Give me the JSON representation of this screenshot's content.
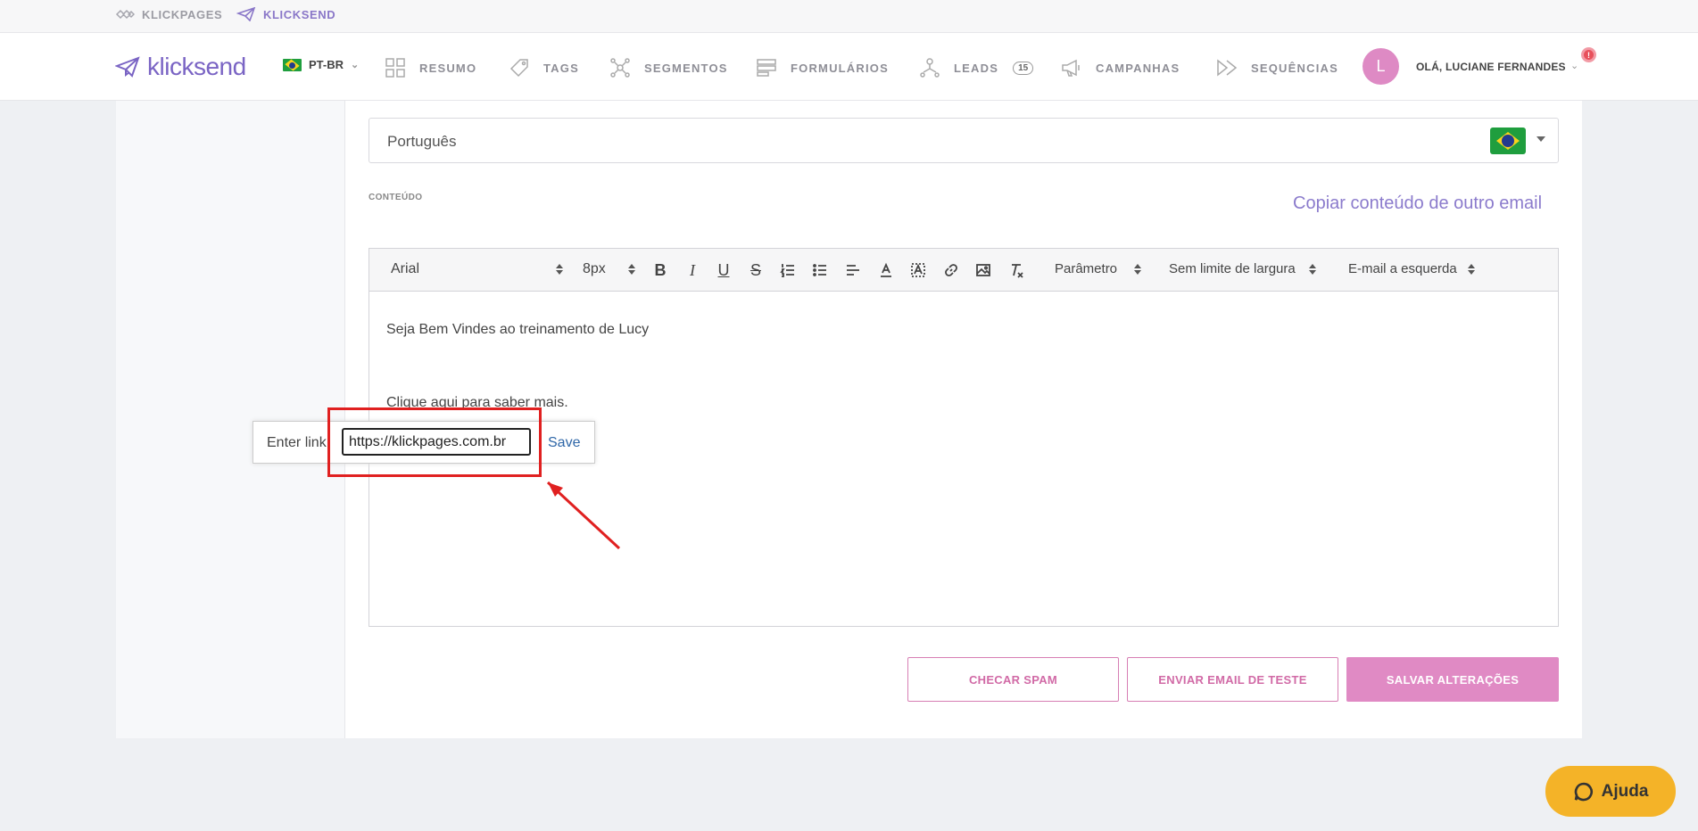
{
  "topbar": {
    "links": [
      {
        "label": "KLICKPAGES",
        "icon": "klickpages-icon"
      },
      {
        "label": "KLICKSEND",
        "icon": "paper-plane-icon"
      }
    ]
  },
  "header": {
    "logo_text": "klicksend",
    "language": "PT-BR",
    "nav": [
      {
        "label": "RESUMO",
        "icon": "grid-icon"
      },
      {
        "label": "TAGS",
        "icon": "tag-icon"
      },
      {
        "label": "SEGMENTOS",
        "icon": "segments-icon"
      },
      {
        "label": "FORMULÁRIOS",
        "icon": "form-icon"
      },
      {
        "label": "LEADS",
        "icon": "leads-icon",
        "badge": "15"
      },
      {
        "label": "CAMPANHAS",
        "icon": "megaphone-icon"
      },
      {
        "label": "SEQUÊNCIAS",
        "icon": "sequence-icon"
      }
    ],
    "avatar_initial": "L",
    "greeting": "OLÁ, LUCIANE FERNANDES",
    "notification": "!"
  },
  "form": {
    "language_value": "Português",
    "content_label": "CONTEÚDO",
    "copy_link": "Copiar conteúdo de outro email"
  },
  "editor": {
    "font": "Arial",
    "size": "8px",
    "parametro": "Parâmetro",
    "width": "Sem limite de largura",
    "align": "E-mail a esquerda",
    "lines": [
      "Seja Bem Vindes ao treinamento de Lucy",
      "Clique aqui para saber mais."
    ]
  },
  "link_tooltip": {
    "label": "Enter link:",
    "value": "https://klickpages.com.br",
    "save": "Save"
  },
  "actions": {
    "spam": "CHECAR SPAM",
    "test": "ENVIAR EMAIL DE TESTE",
    "save": "SALVAR ALTERAÇÕES"
  },
  "help": {
    "label": "Ajuda"
  },
  "colors": {
    "brand": "#7a64c4",
    "accent_pink": "#e08ac4",
    "highlight": "#e02020",
    "help_yellow": "#f4b328"
  }
}
